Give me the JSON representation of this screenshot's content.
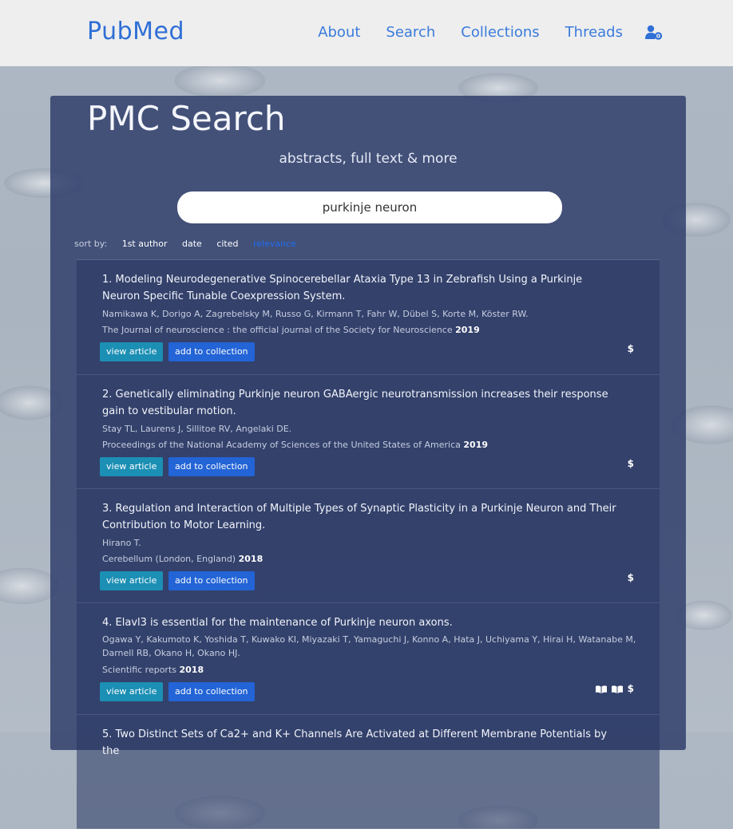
{
  "nav": {
    "brand": "PubMed",
    "links": [
      "About",
      "Search",
      "Collections",
      "Threads"
    ]
  },
  "panel": {
    "title": "PMC Search",
    "subtitle": "abstracts, full text & more",
    "search_value": "purkinje neuron",
    "sort_label": "sort by:",
    "sort_options": [
      "1st author",
      "date",
      "cited",
      "relevance"
    ],
    "active_sort": "relevance"
  },
  "buttons": {
    "view": "view article",
    "add": "add to collection"
  },
  "results": [
    {
      "title": "1. Modeling Neurodegenerative Spinocerebellar Ataxia Type 13 in Zebrafish Using a Purkinje Neuron Specific Tunable Coexpression System.",
      "authors": "Namikawa K, Dorigo A, Zagrebelsky M, Russo G, Kirmann T, Fahr W, Dübel S, Korte M, Köster RW.",
      "journal": "The Journal of neuroscience : the official journal of the Society for Neuroscience",
      "year": "2019",
      "icons": [
        "dollar-icon"
      ],
      "dollar": "$"
    },
    {
      "title": "2. Genetically eliminating Purkinje neuron GABAergic neurotransmission increases their response gain to vestibular motion.",
      "authors": "Stay TL, Laurens J, Sillitoe RV, Angelaki DE.",
      "journal": "Proceedings of the National Academy of Sciences of the United States of America",
      "year": "2019",
      "icons": [
        "dollar-icon"
      ],
      "dollar": "$"
    },
    {
      "title": "3. Regulation and Interaction of Multiple Types of Synaptic Plasticity in a Purkinje Neuron and Their Contribution to Motor Learning.",
      "authors": "Hirano T.",
      "journal": "Cerebellum (London, England)",
      "year": "2018",
      "icons": [
        "dollar-icon"
      ],
      "dollar": "$"
    },
    {
      "title": "4. Elavl3 is essential for the maintenance of Purkinje neuron axons.",
      "authors": "Ogawa Y, Kakumoto K, Yoshida T, Kuwako KI, Miyazaki T, Yamaguchi J, Konno A, Hata J, Uchiyama Y, Hirai H, Watanabe M, Darnell RB, Okano H, Okano HJ.",
      "journal": "Scientific reports",
      "year": "2018",
      "icons": [
        "book-icon",
        "book-icon",
        "dollar-icon"
      ],
      "dollar": "$"
    },
    {
      "title": "5. Two Distinct Sets of Ca2+ and K+ Channels Are Activated at Different Membrane Potentials by the"
    }
  ]
}
